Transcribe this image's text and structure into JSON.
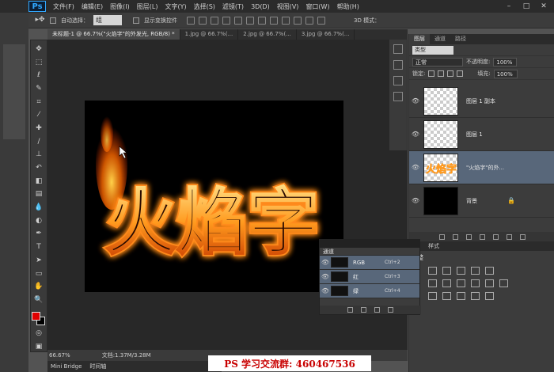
{
  "app": {
    "logo": "Ps",
    "menus": [
      "文件(F)",
      "编辑(E)",
      "图像(I)",
      "图层(L)",
      "文字(Y)",
      "选择(S)",
      "滤镜(T)",
      "3D(D)",
      "视图(V)",
      "窗口(W)",
      "帮助(H)"
    ]
  },
  "options": {
    "auto_select_label": "自动选择：",
    "auto_select_value": "组",
    "show_transform_label": "显示变换控件",
    "mode_3d_label": "3D 模式："
  },
  "doc_tabs": [
    "未标题-1 @ 66.7%(\"火焰字\"的外发光, RGB/8) *",
    "1.jpg @ 66.7%(...",
    "2.jpg @ 66.7%(...",
    "3.jpg @ 66.7%(..."
  ],
  "canvas": {
    "text": "火焰字"
  },
  "status": {
    "zoom": "66.67%",
    "doc_info": "文档:1.37M/3.28M"
  },
  "bottom_tabs": [
    "Mini Bridge",
    "时间轴"
  ],
  "watermark": "PS 学习交流群: 460467536",
  "layers_panel": {
    "tabs": [
      "图层",
      "通道",
      "路径"
    ],
    "filter_label": "类型",
    "blend_mode": "正常",
    "opacity_label": "不透明度:",
    "opacity_value": "100%",
    "lock_label": "锁定:",
    "fill_label": "填充:",
    "fill_value": "100%",
    "layers": [
      {
        "name": "图层 1 副本",
        "thumb": "checker",
        "active": false
      },
      {
        "name": "图层 1",
        "thumb": "checker",
        "active": false
      },
      {
        "name": "\"火焰字\"的外...",
        "thumb": "fire",
        "active": true
      },
      {
        "name": "背景",
        "thumb": "black",
        "active": false,
        "locked": true
      }
    ]
  },
  "adjustments": {
    "header": "样式",
    "title": "调整"
  },
  "channels": {
    "tab": "通道",
    "rows": [
      {
        "name": "RGB",
        "shortcut": "Ctrl+2"
      },
      {
        "name": "红",
        "shortcut": "Ctrl+3"
      },
      {
        "name": "绿",
        "shortcut": "Ctrl+4"
      }
    ]
  },
  "colors": {
    "foreground": "#e00000",
    "background": "#000000",
    "fire_glow": "#ff7a00",
    "fire_core": "#ffd24a"
  },
  "icons": {
    "tools": [
      "move-icon",
      "marquee-icon",
      "lasso-icon",
      "quick-select-icon",
      "crop-icon",
      "eyedropper-icon",
      "healing-icon",
      "brush-icon",
      "stamp-icon",
      "history-brush-icon",
      "eraser-icon",
      "gradient-icon",
      "blur-icon",
      "dodge-icon",
      "pen-icon",
      "type-icon",
      "path-select-icon",
      "shape-icon",
      "hand-icon",
      "zoom-icon"
    ]
  }
}
